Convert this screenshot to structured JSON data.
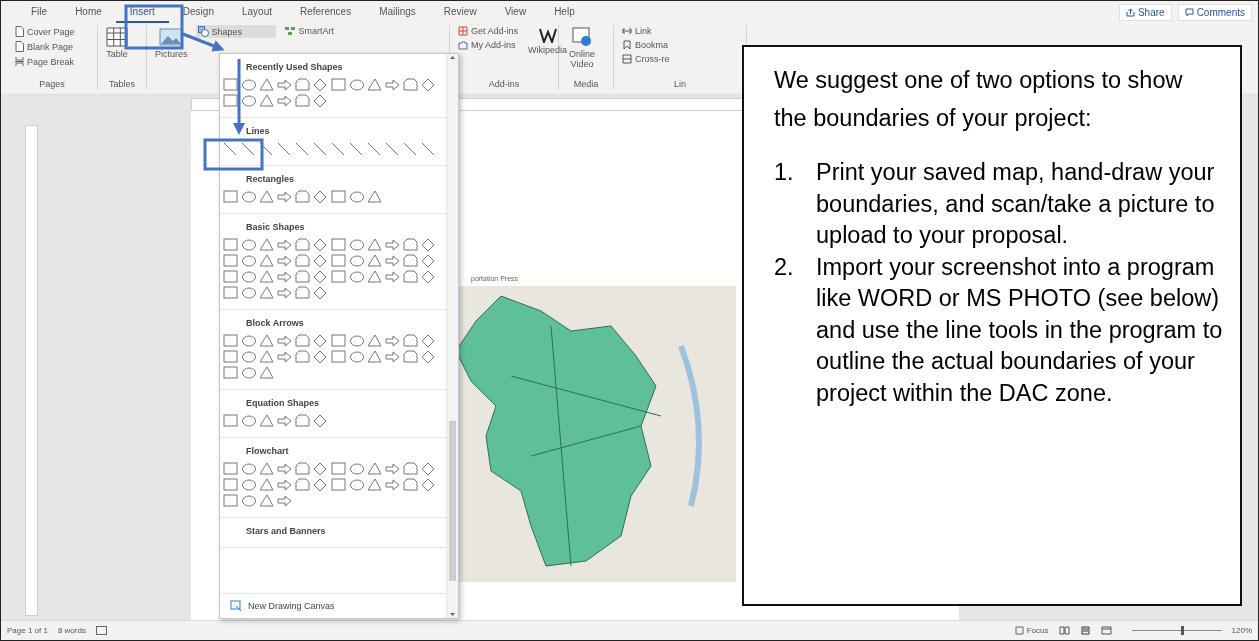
{
  "tabs": [
    {
      "label": "File",
      "selected": false
    },
    {
      "label": "Home",
      "selected": false
    },
    {
      "label": "Insert",
      "selected": true
    },
    {
      "label": "Design",
      "selected": false
    },
    {
      "label": "Layout",
      "selected": false
    },
    {
      "label": "References",
      "selected": false
    },
    {
      "label": "Mailings",
      "selected": false
    },
    {
      "label": "Review",
      "selected": false
    },
    {
      "label": "View",
      "selected": false
    },
    {
      "label": "Help",
      "selected": false
    }
  ],
  "share": "Share",
  "comments": "Comments",
  "ribbon": {
    "pages": {
      "items": [
        "Cover Page",
        "Blank Page",
        "Page Break"
      ],
      "label": "Pages"
    },
    "tables": {
      "button": "Table",
      "label": "Tables"
    },
    "pictures": "Pictures",
    "shapes": "Shapes",
    "smartart": "SmartArt",
    "addins": {
      "get": "Get Add-ins",
      "mine": "My Add-ins",
      "wikipedia": "Wikipedia",
      "label": "Add-ins"
    },
    "media": {
      "button": "Online Video",
      "label": "Media"
    },
    "links": {
      "items": [
        "Link",
        "Bookma",
        "Cross-re"
      ],
      "label": "Lin"
    }
  },
  "shapes_menu": {
    "sections": [
      {
        "title": "Recently Used Shapes"
      },
      {
        "title": "Lines"
      },
      {
        "title": "Rectangles"
      },
      {
        "title": "Basic Shapes"
      },
      {
        "title": "Block Arrows"
      },
      {
        "title": "Equation Shapes"
      },
      {
        "title": "Flowchart"
      },
      {
        "title": "Stars and Banners"
      }
    ],
    "footer": "New Drawing Canvas"
  },
  "document": {
    "map_caption": "portation Press"
  },
  "callout": {
    "intro": "We suggest one of two options to show the boundaries of your project:",
    "steps": [
      {
        "number": "1.",
        "text": "Print your saved map, hand-draw your boundaries, and scan/take a picture to upload to your proposal."
      },
      {
        "number": "2.",
        "text": "Import your screenshot into a program like WORD or MS PHOTO (see below) and use the line tools in the program to outline the actual boundaries of your project within the DAC zone."
      }
    ]
  },
  "status_bar": {
    "page": "Page 1 of 1",
    "words": "8 words",
    "focus": "Focus",
    "zoom": "120%",
    "zoom_slider": {
      "level": 0.55
    }
  }
}
